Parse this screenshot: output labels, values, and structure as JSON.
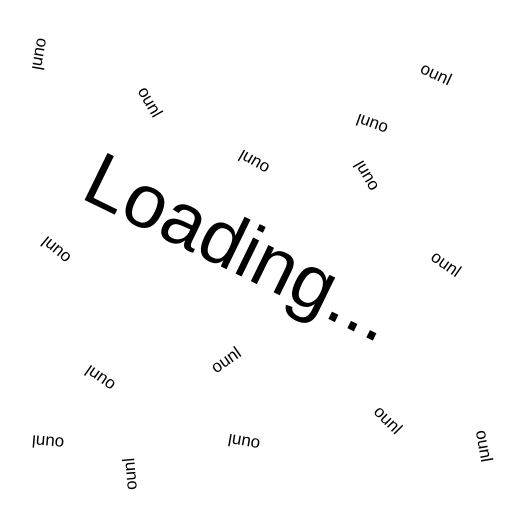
{
  "loading": {
    "text": "Loading..."
  },
  "scattered_words": [
    "ounl",
    "ounl",
    "ounl",
    "ounl",
    "ounl",
    "ounl",
    "ounl",
    "ounl",
    "ounl",
    "ounl",
    "ounl",
    "ounl",
    "ounl",
    "ounl",
    "ounl"
  ],
  "colors": {
    "background": "#ffffff",
    "text": "#000000"
  }
}
